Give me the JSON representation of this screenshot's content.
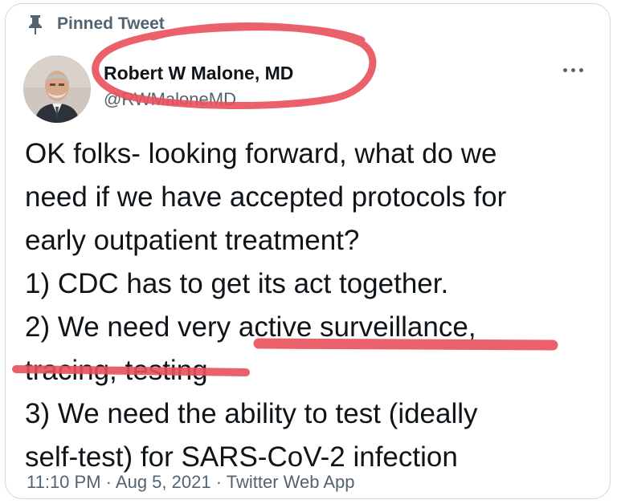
{
  "pinned": {
    "label": "Pinned Tweet",
    "icon": "pin-icon"
  },
  "author": {
    "display_name": "Robert W Malone, MD",
    "handle": "@RWMaloneMD",
    "avatar_icon": "avatar"
  },
  "more_button": {
    "icon": "more-dots-icon"
  },
  "tweet": {
    "lines": [
      "OK folks- looking forward, what do we",
      "need if we have accepted protocols for",
      "early outpatient treatment?",
      "1) CDC has to get its act together.",
      "2) We need very active surveillance,",
      "tracing, testing",
      "3) We need the ability to test (ideally",
      "self-test) for SARS-CoV-2 infection"
    ]
  },
  "meta": {
    "time": "11:10 PM",
    "date": "Aug 5, 2021",
    "source": "Twitter Web App",
    "separator": "·"
  },
  "colors": {
    "annotation_red": "#e8505b",
    "text_primary": "#0f1419",
    "text_secondary": "#536471",
    "card_border": "#cfd9de"
  }
}
